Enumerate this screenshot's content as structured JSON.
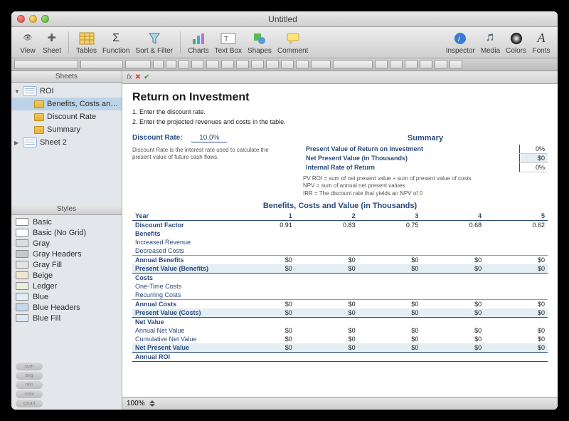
{
  "window": {
    "title": "Untitled"
  },
  "traffic": {
    "close": "close",
    "min": "minimize",
    "max": "zoom"
  },
  "toolbar": {
    "view": "View",
    "sheet": "Sheet",
    "tables": "Tables",
    "function": "Function",
    "sortfilter": "Sort & Filter",
    "charts": "Charts",
    "textbox": "Text Box",
    "shapes": "Shapes",
    "comment": "Comment",
    "inspector": "Inspector",
    "media": "Media",
    "colors": "Colors",
    "fonts": "Fonts"
  },
  "fxbar": {
    "label": "fx"
  },
  "sidebar": {
    "sheets_label": "Sheets",
    "sheet1": {
      "name": "ROI",
      "tables": [
        "Benefits, Costs an…",
        "Discount Rate",
        "Summary"
      ]
    },
    "sheet2": {
      "name": "Sheet 2"
    },
    "styles_label": "Styles",
    "styles": [
      "Basic",
      "Basic (No Grid)",
      "Gray",
      "Gray Headers",
      "Gray Fill",
      "Beige",
      "Ledger",
      "Blue",
      "Blue Headers",
      "Blue Fill"
    ],
    "style_colors": [
      "#ffffff",
      "#ffffff",
      "#dddddd",
      "#c8c8c8",
      "#e4e4e4",
      "#efe7d2",
      "#e9edd9",
      "#e3edf6",
      "#c5d9eb",
      "#dce9f5"
    ],
    "pills": [
      "sum",
      "avg",
      "min",
      "max",
      "count"
    ]
  },
  "doc": {
    "title": "Return on Investment",
    "instructions": [
      "1.  Enter the discount rate.",
      "2.  Enter the projected revenues and costs in the table."
    ],
    "discount": {
      "label": "Discount Rate:",
      "value": "10.0%",
      "note": "Discount Rate is the interest rate used to calculate the present value of future cash flows."
    },
    "summary": {
      "title": "Summary",
      "rows": [
        {
          "label": "Present Value of Return on Investment",
          "val": "0%"
        },
        {
          "label": "Net Present Value (in Thousands)",
          "val": "$0"
        },
        {
          "label": "Internal Rate of Return",
          "val": "0%"
        }
      ],
      "notes": [
        "PV ROI = sum of net present value ÷ sum of present value of costs",
        "NPV = sum of annual net present values",
        "IRR = The discount rate that yields an NPV of 0"
      ]
    },
    "table": {
      "title": "Benefits, Costs and Value (in Thousands)",
      "yearLabel": "Year",
      "years": [
        "1",
        "2",
        "3",
        "4",
        "5"
      ],
      "rows": [
        {
          "label": "Discount Factor",
          "cls": "",
          "vals": [
            "0.91",
            "0.83",
            "0.75",
            "0.68",
            "0.62"
          ]
        },
        {
          "label": "Benefits",
          "cls": "hdr",
          "vals": [
            "",
            "",
            "",
            "",
            ""
          ]
        },
        {
          "label": "Increased Revenue",
          "cls": "sub",
          "vals": [
            "",
            "",
            "",
            "",
            ""
          ]
        },
        {
          "label": "Decreased Costs",
          "cls": "sub",
          "vals": [
            "",
            "",
            "",
            "",
            ""
          ]
        },
        {
          "label": "Annual Benefits",
          "cls": "tot",
          "vals": [
            "$0",
            "$0",
            "$0",
            "$0",
            "$0"
          ]
        },
        {
          "label": "Present Value (Benefits)",
          "cls": "pv",
          "vals": [
            "$0",
            "$0",
            "$0",
            "$0",
            "$0"
          ]
        },
        {
          "label": "Costs",
          "cls": "hdr",
          "vals": [
            "",
            "",
            "",
            "",
            ""
          ]
        },
        {
          "label": "One-Time Costs",
          "cls": "sub",
          "vals": [
            "",
            "",
            "",
            "",
            ""
          ]
        },
        {
          "label": "Recurring Costs",
          "cls": "sub",
          "vals": [
            "",
            "",
            "",
            "",
            ""
          ]
        },
        {
          "label": "Annual Costs",
          "cls": "tot",
          "vals": [
            "$0",
            "$0",
            "$0",
            "$0",
            "$0"
          ]
        },
        {
          "label": "Present Value (Costs)",
          "cls": "pv",
          "vals": [
            "$0",
            "$0",
            "$0",
            "$0",
            "$0"
          ]
        },
        {
          "label": "Net Value",
          "cls": "hdr",
          "vals": [
            "",
            "",
            "",
            "",
            ""
          ]
        },
        {
          "label": "Annual Net Value",
          "cls": "sub",
          "vals": [
            "$0",
            "$0",
            "$0",
            "$0",
            "$0"
          ]
        },
        {
          "label": "Cumulative Net Value",
          "cls": "sub",
          "vals": [
            "$0",
            "$0",
            "$0",
            "$0",
            "$0"
          ]
        },
        {
          "label": "Net Present Value",
          "cls": "pv",
          "vals": [
            "$0",
            "$0",
            "$0",
            "$0",
            "$0"
          ]
        },
        {
          "label": "Annual ROI",
          "cls": "line",
          "vals": [
            "",
            "",
            "",
            "",
            ""
          ]
        }
      ]
    }
  },
  "zoom": {
    "value": "100%"
  }
}
